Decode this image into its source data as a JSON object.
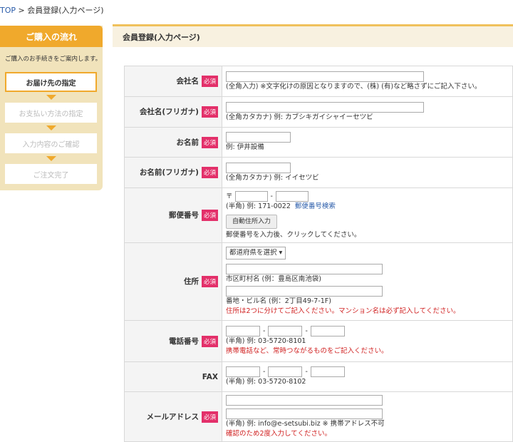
{
  "breadcrumb": {
    "top": "TOP",
    "sep": " > ",
    "current": "会員登録(入力ページ)"
  },
  "sidebar": {
    "title": "ご購入の流れ",
    "description": "ご購入のお手続きをご案内します。",
    "steps": [
      "お届け先の指定",
      "お支払い方法の指定",
      "入力内容のご確認",
      "ご注文完了"
    ]
  },
  "main": {
    "title": "会員登録(入力ページ)"
  },
  "required_badge": "必須",
  "form": {
    "company": {
      "label": "会社名",
      "note": "(全角入力) ※文字化けの原因となりますので、(株) (有)など略さずにご記入下さい。"
    },
    "company_kana": {
      "label": "会社名(フリガナ)",
      "note": "(全角カタカナ) 例: カブシキガイシャイーセツビ"
    },
    "name": {
      "label": "お名前",
      "note": "例: 伊井設備"
    },
    "name_kana": {
      "label": "お名前(フリガナ)",
      "note": "(全角カタカナ) 例: イイセツビ"
    },
    "postal": {
      "label": "郵便番号",
      "prefix": "〒",
      "dash": "-",
      "note": "(半角) 例: 171-0022",
      "search_link": "郵便番号検索",
      "auto_button": "自動住所入力",
      "auto_note": "郵便番号を入力後、クリックしてください。"
    },
    "address": {
      "label": "住所",
      "pref_select": "都道府県を選択 ▾",
      "city_note": "市区町村名 (例：豊島区南池袋)",
      "street_note": "番地・ビル名 (例：2丁目49-7-1F)",
      "warning": "住所は2つに分けてご記入ください。マンション名は必ず記入してください。"
    },
    "phone": {
      "label": "電話番号",
      "dash": "-",
      "note": "(半角) 例: 03-5720-8101",
      "warning": "携帯電話など、常時つながるものをご記入ください。"
    },
    "fax": {
      "label": "FAX",
      "dash": "-",
      "note": "(半角) 例: 03-5720-8102"
    },
    "email": {
      "label": "メールアドレス",
      "note": "(半角) 例: info@e-setsubi.biz ※ 携帯アドレス不可",
      "warning": "確認のため2度入力してください。"
    }
  }
}
